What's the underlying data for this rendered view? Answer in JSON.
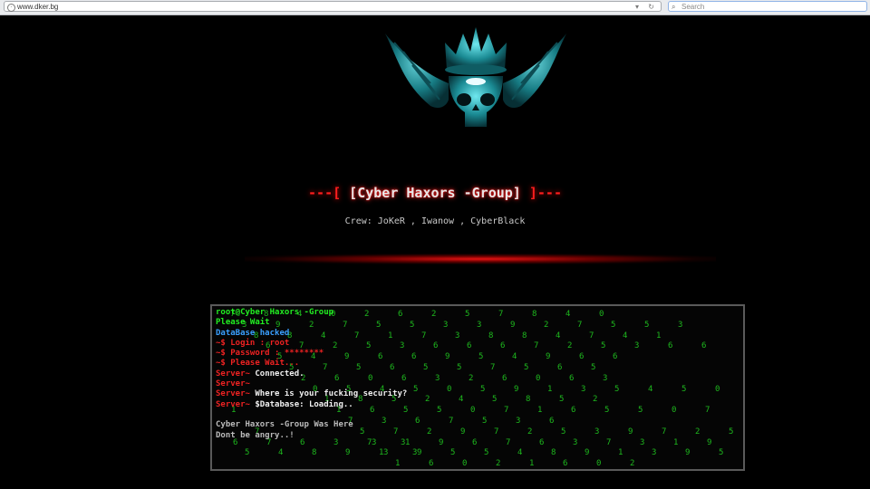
{
  "browser": {
    "url": "www.dker.bg",
    "search_placeholder": "Search",
    "nav_glyphs": "▾ ↻"
  },
  "hero": {
    "title_left": "---[",
    "title": "[Cyber Haxors -Group]",
    "title_right": "]---",
    "crew": "Crew: JoKeR , Iwanow , CyberBlack"
  },
  "terminal": {
    "lines": [
      {
        "text": "root@Cyber Haxors -Group",
        "color": "green"
      },
      {
        "text": "Please Wait",
        "color": "green"
      },
      {
        "text": "DataBase hacked",
        "color": "blue"
      },
      {
        "text": "~$ Login : root",
        "color": "red"
      },
      {
        "text": "~$ Password : ********",
        "color": "red"
      },
      {
        "text": "~$ Please Wait...",
        "color": "red"
      },
      {
        "text": "Server~ Connected.",
        "color": "mixed_server"
      },
      {
        "text": "Server~ ",
        "color": "red"
      },
      {
        "text": "Server~ Where is your fucking security?",
        "color": "mixed_server"
      },
      {
        "text": "Server~ $Database: Loading..",
        "color": "mixed_server"
      },
      {
        "text": "",
        "color": "green"
      },
      {
        "text": "Cyber Haxors -Group Was Here",
        "color": "grey"
      },
      {
        "text": "Dont be angry..!",
        "color": "grey"
      }
    ],
    "rain": [
      "7 8 4 0 2 6 2 5 7 8 4 0",
      "3 9 2 7 5 5 3 3 9 2 7 5 5 3",
      "8 8 4 7 1 7 3 8 8 4 7 4 1",
      "6 7 2 5 3 6 6 6 7 2 5 3 6 6",
      "5 4 9 6 6 9 5 4 9 6 6",
      "5 7 5 6 5 5 7 5 6 5",
      "2 6 0 6 3 2 6 0 6 3",
      "0 5 4 5 0 5 9 1 3 5 4 5 0",
      "1 8 5 2 4 5 8 5 2",
      "1 6 5 5 0 7 1 6 5 5 0 7 1",
      "7 3 6 7 5 3 6",
      "5 7 2 9 7 2 5 3 9 7 2 5 7",
      "3 1 9 6 7 6 3 7 3 1 9 6 7 6 3 7 3",
      "3 9 5 5 4 8 9 1 3 9 5 5 4 8 9 1 3",
      "1 6 0 2 1 6 0 2"
    ]
  }
}
